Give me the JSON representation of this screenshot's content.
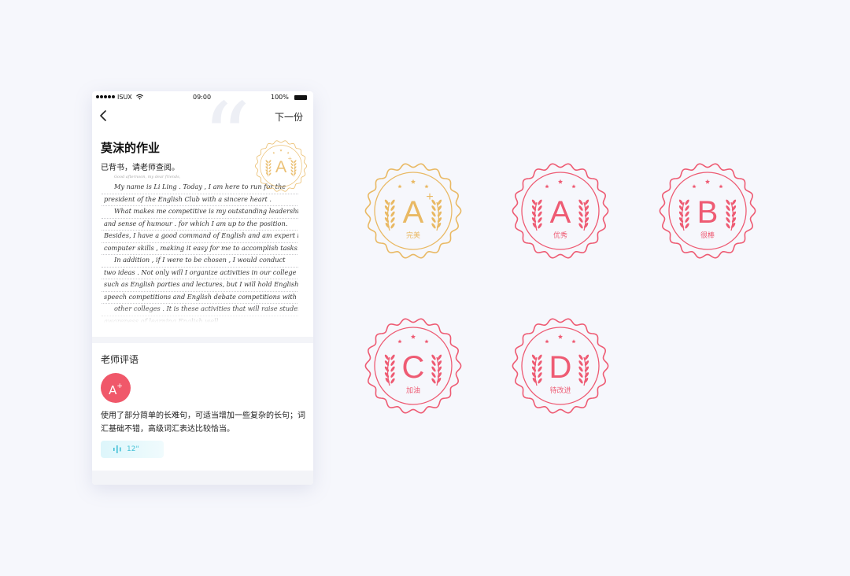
{
  "status_bar": {
    "carrier": "ISUX",
    "time": "09:00",
    "battery": "100%"
  },
  "nav": {
    "back_icon": "chevron-left-icon",
    "next_label": "下一份"
  },
  "homework": {
    "title": "莫沫的作业",
    "subtitle": "已背书，请老师查阅。",
    "paper_header": "Good afternoon, my dear friends,",
    "paper_lines": [
      "My name is Li Ling . Today , I am here to run for the",
      "president of the English Club with a sincere heart .",
      "What makes me competitive is my outstanding leadership",
      "and sense of humour . for which I am up to the position.",
      "Besides, I have a good command of English and am expert in",
      "computer skills , making it easy for me to accomplish tasks.",
      "In addition , if I were to be chosen , I would conduct",
      "two ideas . Not only will I organize activities in our college",
      "such as English parties and lectures, but I will hold English",
      "speech competitions and English debate competitions with",
      "other colleges . It is these activities that will raise students'",
      "awareness of learning English well ."
    ]
  },
  "teacher_comment": {
    "heading": "老师评语",
    "grade_letter": "A",
    "grade_plus": "+",
    "text": "使用了部分简单的长难句，可适当增加一些复杂的长句；词汇基础不错，高级词汇表达比较恰当。",
    "voice_duration": "12\""
  },
  "stamps": [
    {
      "grade": "A",
      "plus": "+",
      "label": "完美",
      "color": "#e9b964"
    },
    {
      "grade": "A",
      "plus": "",
      "label": "优秀",
      "color": "#ee5b73"
    },
    {
      "grade": "B",
      "plus": "",
      "label": "很棒",
      "color": "#ee5b73"
    },
    {
      "grade": "C",
      "plus": "",
      "label": "加油",
      "color": "#ee5b73"
    },
    {
      "grade": "D",
      "plus": "",
      "label": "待改进",
      "color": "#ee5b73"
    }
  ],
  "colors": {
    "background": "#f6f7fc",
    "gold": "#e9b964",
    "red": "#ee5b73",
    "voice": "#42c0d6"
  }
}
